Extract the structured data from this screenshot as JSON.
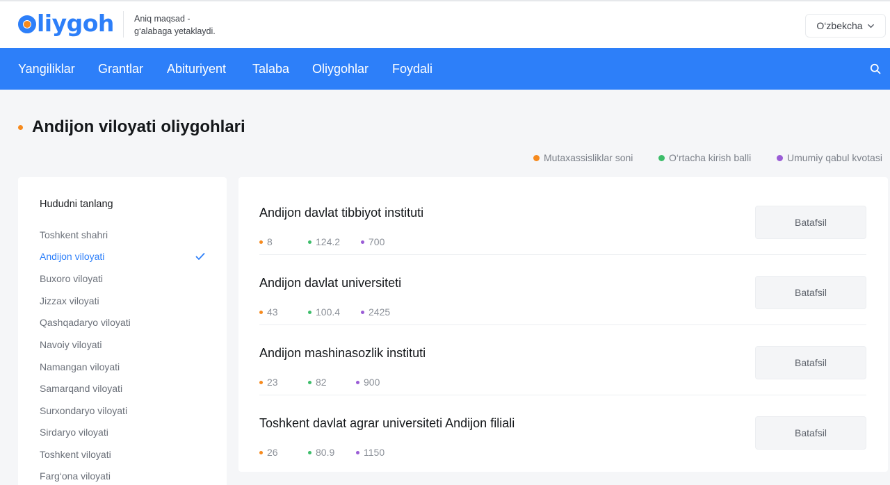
{
  "header": {
    "logo": {
      "rest": "liygoh",
      "alt": "Oliygoh"
    },
    "tagline": {
      "line1": "Aniq maqsad -",
      "line2": "g‘alabaga yetaklaydi."
    },
    "language": {
      "label": "O‘zbekcha",
      "icon": "chevron-down-icon"
    }
  },
  "nav": {
    "items": [
      "Yangiliklar",
      "Grantlar",
      "Abituriyent",
      "Talaba",
      "Oliygohlar",
      "Foydali"
    ],
    "search_icon": "search-icon"
  },
  "page": {
    "title": "Andijon viloyati oliygohlari"
  },
  "legend": [
    {
      "label": "Mutaxassisliklar soni",
      "color": "#f68a1e"
    },
    {
      "label": "O‘rtacha kirish balli",
      "color": "#3dbd6a"
    },
    {
      "label": "Umumiy qabul kvotasi",
      "color": "#9a5cd6"
    }
  ],
  "sidebar": {
    "title": "Hududni tanlang",
    "regions": [
      {
        "label": "Toshkent shahri",
        "active": false
      },
      {
        "label": "Andijon viloyati",
        "active": true
      },
      {
        "label": "Buxoro viloyati",
        "active": false
      },
      {
        "label": "Jizzax viloyati",
        "active": false
      },
      {
        "label": "Qashqadaryo viloyati",
        "active": false
      },
      {
        "label": "Navoiy viloyati",
        "active": false
      },
      {
        "label": "Namangan viloyati",
        "active": false
      },
      {
        "label": "Samarqand viloyati",
        "active": false
      },
      {
        "label": "Surxondaryo viloyati",
        "active": false
      },
      {
        "label": "Sirdaryo viloyati",
        "active": false
      },
      {
        "label": "Toshkent viloyati",
        "active": false
      },
      {
        "label": "Farg‘ona viloyati",
        "active": false
      }
    ]
  },
  "universities": [
    {
      "name": "Andijon davlat tibbiyot instituti",
      "specialties": "8",
      "avg_score": "124.2",
      "quota": "700",
      "button": "Batafsil"
    },
    {
      "name": "Andijon davlat universiteti",
      "specialties": "43",
      "avg_score": "100.4",
      "quota": "2425",
      "button": "Batafsil"
    },
    {
      "name": "Andijon mashinasozlik instituti",
      "specialties": "23",
      "avg_score": "82",
      "quota": "900",
      "button": "Batafsil"
    },
    {
      "name": "Toshkent davlat agrar universiteti Andijon filiali",
      "specialties": "26",
      "avg_score": "80.9",
      "quota": "1150",
      "button": "Batafsil"
    }
  ],
  "colors": {
    "brand": "#2d7ff9",
    "accent_orange": "#f68a1e",
    "green": "#3dbd6a",
    "purple": "#9a5cd6"
  }
}
